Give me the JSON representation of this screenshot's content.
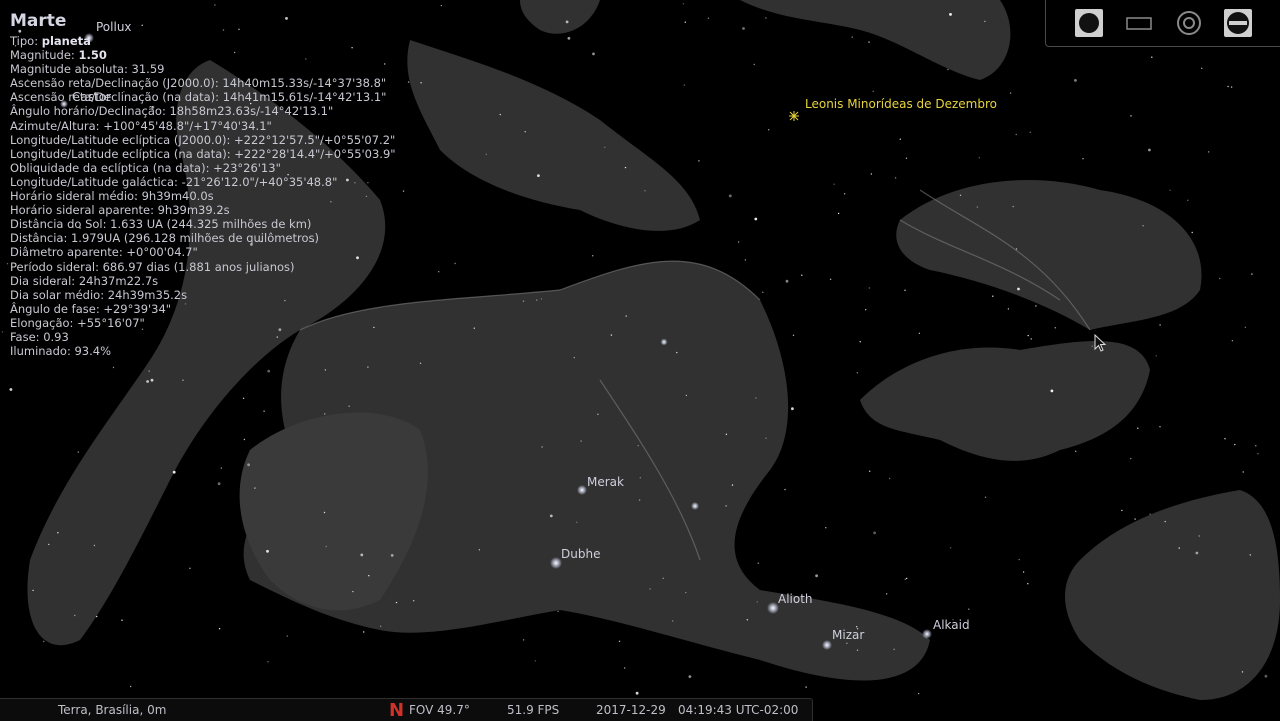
{
  "object": {
    "name": "Marte",
    "type_label": "Tipo: ",
    "type_value": "planeta",
    "mag_label": "Magnitude: ",
    "mag_value": "1.50",
    "lines": [
      "Magnitude absoluta: 31.59",
      "Ascensão reta/Declinação (J2000.0): 14h40m15.33s/-14°37'38.8\"",
      "Ascensão reta/Declinação (na data): 14h41m15.61s/-14°42'13.1\"",
      "Ângulo horário/Declinação: 18h58m23.63s/-14°42'13.1\"",
      "Azimute/Altura: +100°45'48.8\"/+17°40'34.1\"",
      "Longitude/Latitude eclíptica (J2000.0): +222°12'57.5\"/+0°55'07.2\"",
      "Longitude/Latitude eclíptica (na data): +222°28'14.4\"/+0°55'03.9\"",
      "Obliquidade da eclíptica (na data): +23°26'13\"",
      "Longitude/Latitude galáctica: -21°26'12.0\"/+40°35'48.8\"",
      "Horário sideral médio: 9h39m40.0s",
      "Horário sideral aparente: 9h39m39.2s",
      "Distância do Sol: 1.633 UA (244.325 milhões de km)",
      "Distância: 1.979UA (296.128 milhões de quilômetros)",
      "Diâmetro aparente: +0°00'04.7\"",
      "Período sideral: 686.97 dias (1.881 anos julianos)",
      "Dia sideral: 24h37m22.7s",
      "Dia solar médio: 24h39m35.2s",
      "Ângulo de fase: +29°39'34\"",
      "Elongação: +55°16'07\"",
      "Fase: 0.93",
      "Iluminado: 93.4%"
    ]
  },
  "sky_labels": {
    "pollux": "Pollux",
    "castor": "Castor",
    "merak": "Merak",
    "dubhe": "Dubhe",
    "alioth": "Alioth",
    "mizar": "Mizar",
    "alkaid": "Alkaid",
    "meteor_shower": "Leonis Minorídeas de Dezembro"
  },
  "toolbar": {
    "icons": [
      "planet-disc-icon",
      "window-rectangle-icon",
      "target-circle-icon",
      "ground-horizon-icon"
    ]
  },
  "status": {
    "location": "Terra, Brasília, 0m",
    "compass": "N",
    "fov": "FOV 49.7°",
    "fps": "51.9 FPS",
    "date": "2017-12-29",
    "time": "04:19:43 UTC-02:00"
  },
  "colors": {
    "background": "#000000",
    "constellation_art": "#8a8a8a",
    "label": "#c9c9d6",
    "meteor_label": "#e8d43c",
    "compass": "#d03228"
  }
}
